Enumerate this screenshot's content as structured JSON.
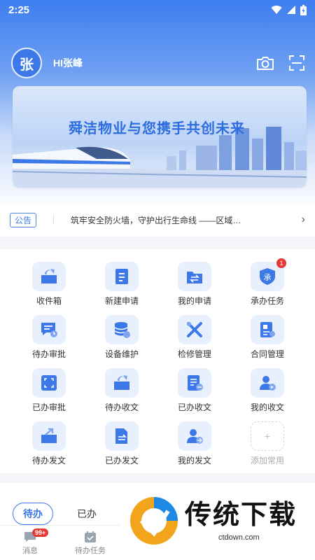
{
  "status_bar": {
    "time": "2:25"
  },
  "profile": {
    "avatar_text": "张",
    "greeting": "HI张峰"
  },
  "banner": {
    "title": "舜洁物业与您携手共创未来"
  },
  "notice": {
    "tag": "公告",
    "text": "筑牢安全防火墙，守护出行生命线 ——区域…"
  },
  "grid": {
    "items": [
      {
        "label": "收件箱",
        "icon": "inbox-icon"
      },
      {
        "label": "新建申请",
        "icon": "new-application-icon"
      },
      {
        "label": "我的申请",
        "icon": "my-application-icon"
      },
      {
        "label": "承办任务",
        "icon": "undertake-task-icon",
        "badge": "1"
      },
      {
        "label": "待办审批",
        "icon": "pending-approval-icon"
      },
      {
        "label": "设备维护",
        "icon": "equipment-maintenance-icon"
      },
      {
        "label": "检修管理",
        "icon": "repair-management-icon"
      },
      {
        "label": "合同管理",
        "icon": "contract-management-icon"
      },
      {
        "label": "已办审批",
        "icon": "done-approval-icon"
      },
      {
        "label": "待办收文",
        "icon": "pending-receive-doc-icon"
      },
      {
        "label": "已办收文",
        "icon": "done-receive-doc-icon"
      },
      {
        "label": "我的收文",
        "icon": "my-receive-doc-icon"
      },
      {
        "label": "待办发文",
        "icon": "pending-send-doc-icon"
      },
      {
        "label": "已办发文",
        "icon": "done-send-doc-icon"
      },
      {
        "label": "我的发文",
        "icon": "my-send-doc-icon"
      },
      {
        "label": "添加常用",
        "icon": "add-icon"
      }
    ]
  },
  "task_tabs": {
    "active": "待办",
    "inactive": "已办"
  },
  "bottom_nav": {
    "items": [
      {
        "label": "消息",
        "badge": "99+",
        "icon": "message-icon"
      },
      {
        "label": "待办任务",
        "icon": "calendar-task-icon"
      }
    ]
  },
  "watermark": {
    "name": "传统下载",
    "url": "ctdown.com"
  },
  "colors": {
    "primary": "#3d78e8",
    "badge": "#e53935",
    "tile": "#e8f0fe"
  }
}
